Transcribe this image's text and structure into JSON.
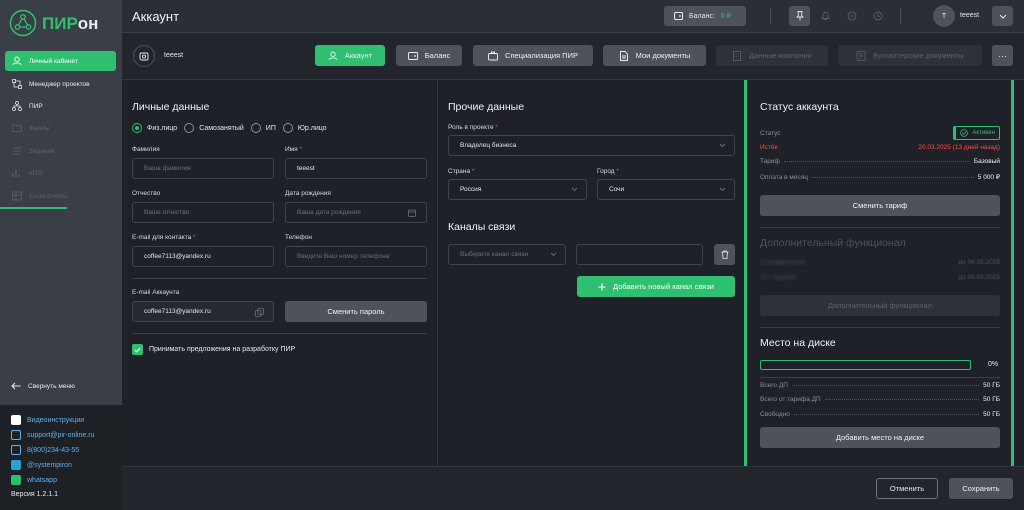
{
  "app": {
    "logo_a": "ПИР",
    "logo_b": "он"
  },
  "sidebar": {
    "items": [
      {
        "label": "Личный кабинет",
        "active": true,
        "icon": "user-icon"
      },
      {
        "label": "Менеджер проектов",
        "active": false,
        "icon": "hierarchy-icon"
      },
      {
        "label": "ПИР",
        "active": false,
        "icon": "tree-icon"
      },
      {
        "label": "Файлы",
        "active": false,
        "dim": true,
        "icon": "folder-icon"
      },
      {
        "label": "Задания",
        "active": false,
        "dim": true,
        "icon": "tasks-icon"
      },
      {
        "label": "КПЭ",
        "active": false,
        "dim": true,
        "icon": "kpi-icon"
      },
      {
        "label": "Excel отчеты",
        "active": false,
        "dim": true,
        "icon": "table-icon"
      }
    ],
    "collapse_label": "Свернуть меню",
    "links": [
      {
        "label": "Видеоинструкции",
        "icon": "video-icon"
      },
      {
        "label": "support@pir-online.ru",
        "icon": "mail-icon"
      },
      {
        "label": "8(800)234-43-55",
        "icon": "phone-icon"
      },
      {
        "label": "@systempiron",
        "icon": "telegram-icon"
      },
      {
        "label": "whatsapp",
        "icon": "whatsapp-icon"
      }
    ],
    "version": "Версия 1.2.1.1"
  },
  "header": {
    "title": "Аккаунт",
    "balance_label": "Баланс:",
    "balance_value": "0 ₽",
    "user_initial": "T",
    "user_name": "teeest"
  },
  "tabs": {
    "account_name": "teeest",
    "items": [
      {
        "label": "Аккаунт",
        "style": "green",
        "icon": "user-icon"
      },
      {
        "label": "Баланс",
        "style": "normal",
        "icon": "wallet-icon"
      },
      {
        "label": "Специализация ПИР",
        "style": "normal",
        "icon": "briefcase-icon"
      },
      {
        "label": "Мои документы",
        "style": "normal",
        "icon": "document-icon"
      },
      {
        "label": "Данные компании",
        "style": "disabled",
        "icon": "building-icon"
      },
      {
        "label": "Бухгалтерские документы",
        "style": "disabled",
        "icon": "ledger-icon"
      }
    ],
    "more": "···"
  },
  "personal": {
    "title": "Личные данные",
    "types": [
      "Физ.лицо",
      "Самозанятый",
      "ИП",
      "Юр.лицо"
    ],
    "selected_type": "Физ.лицо",
    "surname_label": "Фамилия",
    "surname_placeholder": "Ваша фамилия",
    "name_label": "Имя",
    "name_value": "teeest",
    "patronymic_label": "Отчество",
    "patronymic_placeholder": "Ваше отчество",
    "birth_label": "Дата рождения",
    "birth_placeholder": "Ваша дата рождения",
    "email_contact_label": "E-mail для контакта",
    "email_contact_value": "coffee7113@yandex.ru",
    "phone_label": "Телефон",
    "phone_placeholder": "Введите Ваш номер телефона",
    "email_account_label": "E-mail Аккаунта",
    "email_account_value": "coffee7113@yandex.ru",
    "change_password": "Сменить пароль",
    "consent": "Принимать предложения на разработку ПИР",
    "consent_checked": true
  },
  "other": {
    "title": "Прочие данные",
    "role_label": "Роль в проекте",
    "role_value": "Владелец бизнеса",
    "country_label": "Страна",
    "country_value": "Россия",
    "city_label": "Город",
    "city_value": "Сочи",
    "channels_title": "Каналы связи",
    "channel_placeholder": "Выберите канал связи",
    "add_channel": "Добавить новый канал связи"
  },
  "status": {
    "title": "Статус аккаунта",
    "status_label": "Статус",
    "status_value": "Активен",
    "expires_label": "Истёк",
    "expires_value": "20.03.2025 (13 дней назад)",
    "tariff_label": "Тариф",
    "tariff_value": "Базовый",
    "monthly_label": "Оплата в месяц",
    "monthly_value": "5 000 ₽",
    "change_tariff": "Сменить тариф",
    "extra_title": "Дополнительный функционал",
    "extra_rows": [
      {
        "k": "Х-шифрование",
        "v": "до 06.05.2025"
      },
      {
        "k": "Эл. подпись",
        "v": "до 06.05.2025"
      }
    ],
    "extra_button": "Дополнительный функционал"
  },
  "disk": {
    "title": "Место на диске",
    "percent_label": "0%",
    "used_fraction": 0,
    "rows": [
      {
        "k": "Всего ДП",
        "v": "50 ГБ"
      },
      {
        "k": "Всего от тарифа ДП",
        "v": "50 ГБ"
      },
      {
        "k": "Свободно",
        "v": "50 ГБ"
      }
    ],
    "add_button": "Добавить место на диске"
  },
  "footer": {
    "cancel": "Отменить",
    "save": "Сохранить"
  },
  "colors": {
    "accent": "#2fbf71",
    "danger": "#ff4d4d",
    "link": "#62b0f0"
  }
}
